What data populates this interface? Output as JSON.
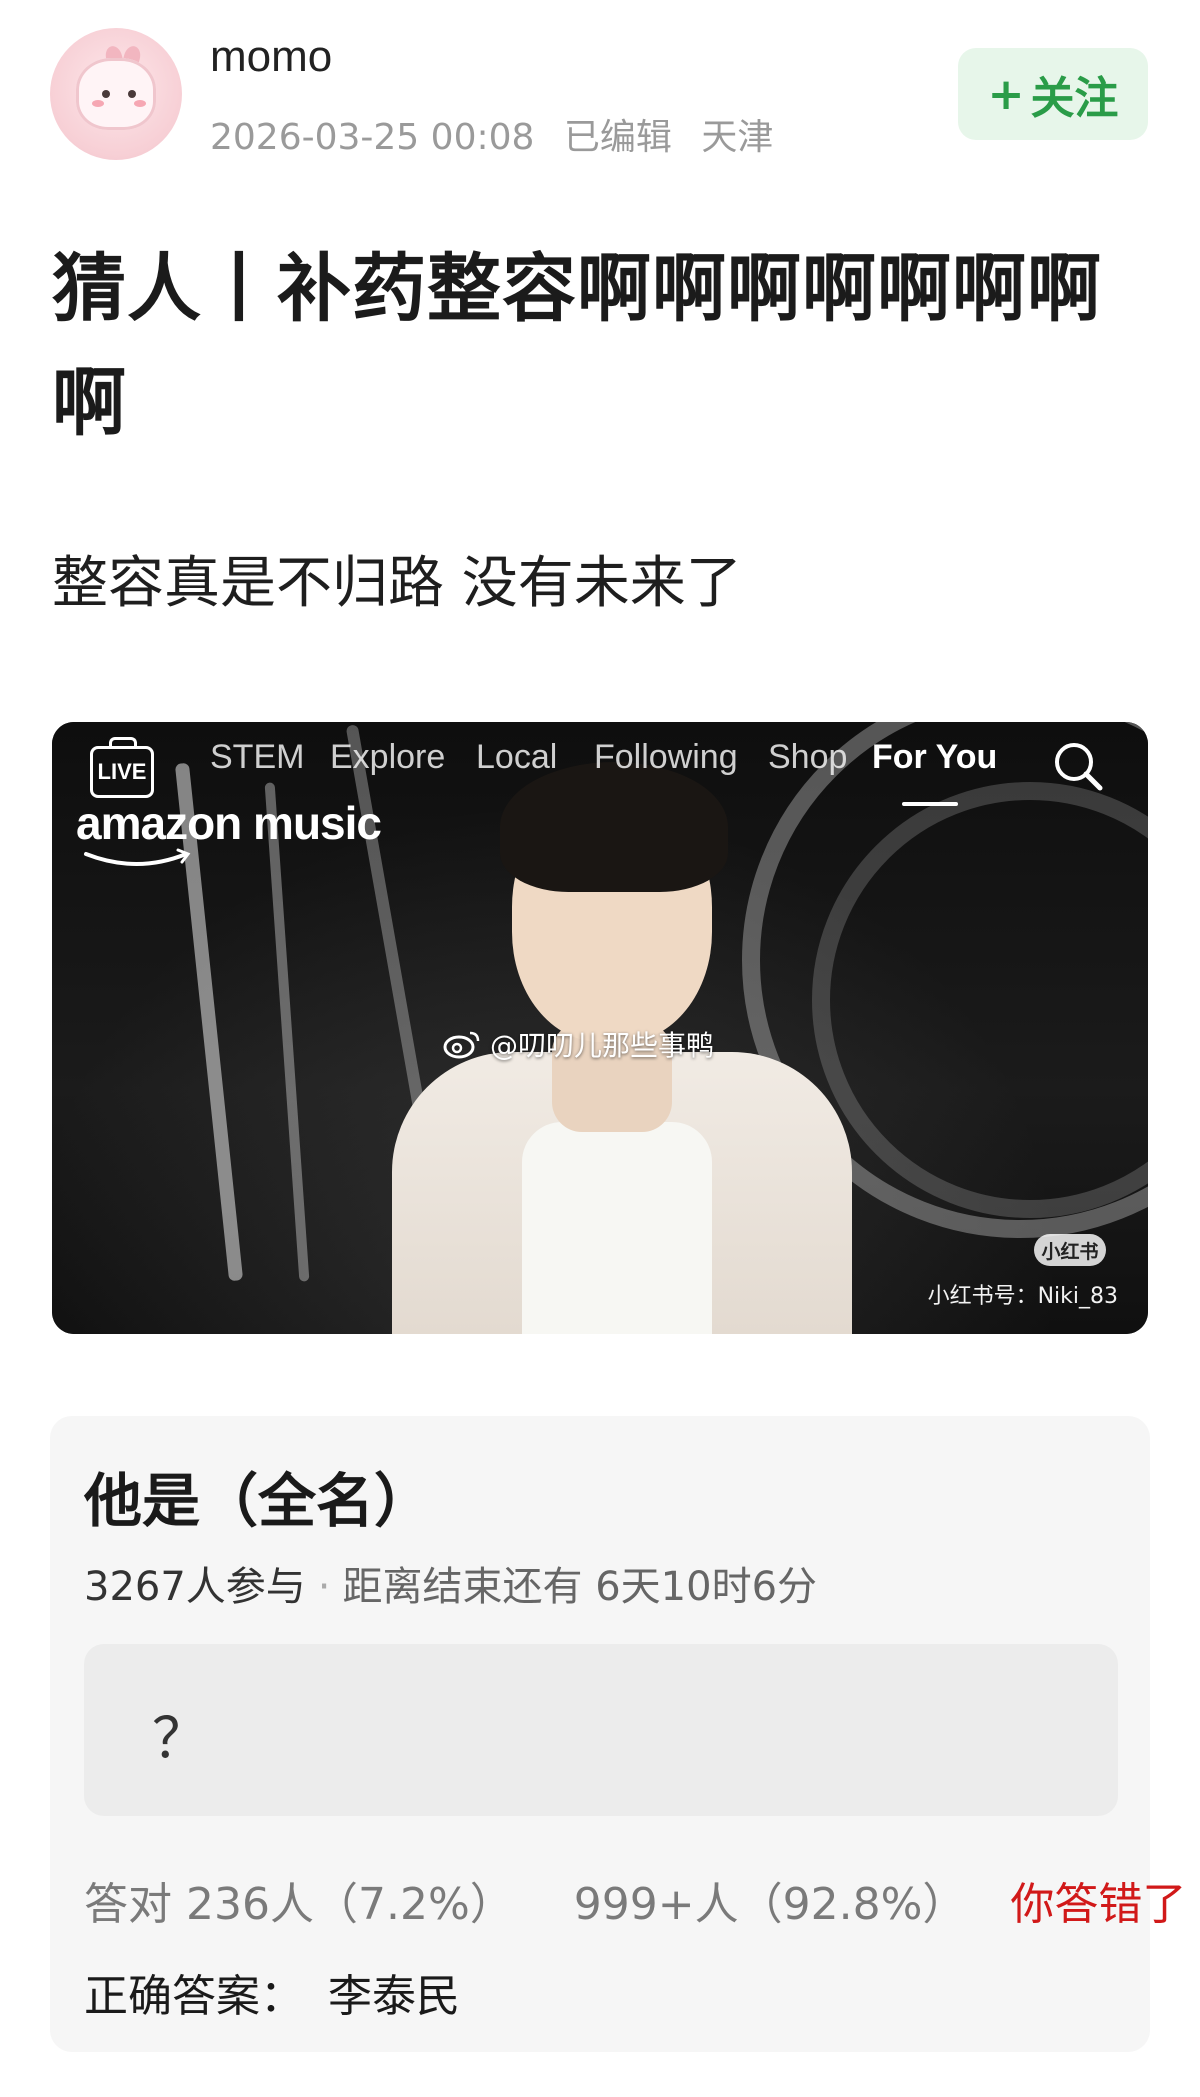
{
  "author": {
    "username": "momo",
    "date": "2026-03-25 00:08",
    "edited_label": "已编辑",
    "location": "天津",
    "follow_label": "关注"
  },
  "post": {
    "title": "猜人丨补药整容啊啊啊啊啊啊啊啊",
    "body": "整容真是不归路 没有未来了"
  },
  "video": {
    "live_label": "LIVE",
    "tabs": [
      "STEM",
      "Explore",
      "Local",
      "Following",
      "Shop",
      "For You"
    ],
    "active_tab": "For You",
    "brand": "amazon music",
    "weibo_watermark": "@叨叨儿那些事鸭",
    "xhs_badge": "小红书",
    "xhs_id": "小红书号：Niki_83"
  },
  "quiz": {
    "question": "他是（全名）",
    "participants": "3267人参与",
    "separator": "·",
    "time_left": "距离结束还有 6天10时6分",
    "my_answer": "？",
    "correct_label": "答对 236人（7.2%）",
    "wrong_count": "999+人（92.8%）",
    "wrong_label": "你答错了",
    "answer_label": "正确答案：",
    "answer_value": "李泰民"
  },
  "colors": {
    "follow_bg": "#e7f6ea",
    "follow_text": "#2a9c48",
    "wrong": "#d11919"
  }
}
